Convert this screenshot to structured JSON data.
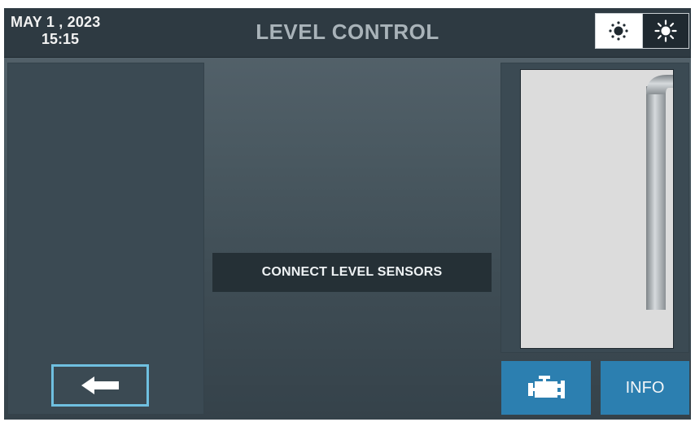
{
  "header": {
    "date": "MAY  1 , 2023",
    "time": "15:15",
    "title": "LEVEL CONTROL",
    "brightness_low_icon": "sun-dim-icon",
    "brightness_high_icon": "sun-bright-icon"
  },
  "main": {
    "message": "CONNECT LEVEL SENSORS"
  },
  "nav": {
    "back_icon": "left-arrow-icon",
    "engine_icon": "engine-icon",
    "info_label": "INFO"
  },
  "colors": {
    "accent_button": "#2c7fb0",
    "back_border": "#6fc0e0",
    "header_bg": "#2e3a42",
    "tank_fill": "#dcdcdc"
  }
}
